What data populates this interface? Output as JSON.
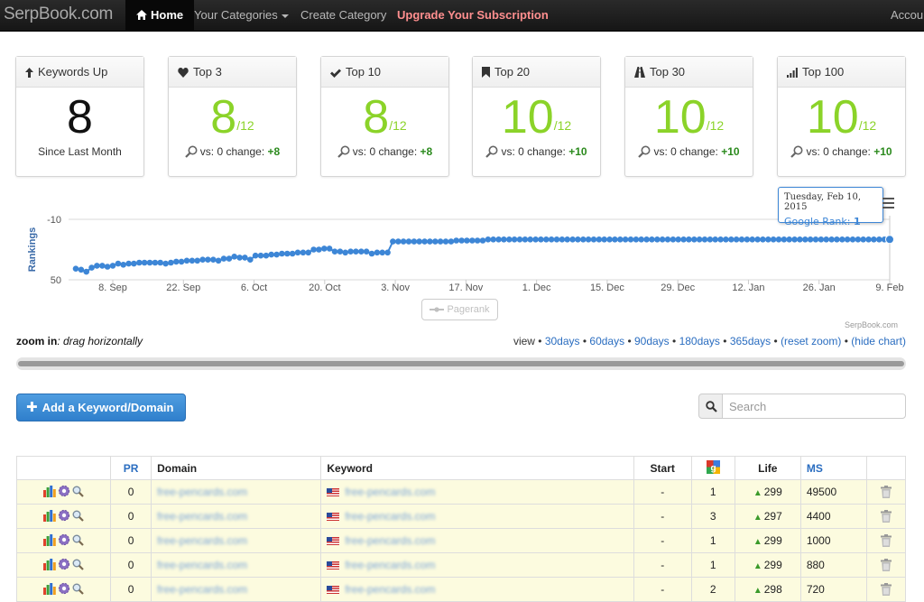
{
  "nav": {
    "brand": "SerpBook.com",
    "home": "Home",
    "categories": "Your Categories",
    "create": "Create Category",
    "upgrade": "Upgrade Your Subscription",
    "account": "Accou"
  },
  "cards": [
    {
      "title": "Keywords Up",
      "icon": "arrow-up-icon",
      "value": "8",
      "suffix": "",
      "foot_text": "Since Last Month",
      "change": ""
    },
    {
      "title": "Top 3",
      "icon": "heart-icon",
      "value": "8",
      "suffix": "/12",
      "foot_text": "vs: 0 change:",
      "change": "+8"
    },
    {
      "title": "Top 10",
      "icon": "check-icon",
      "value": "8",
      "suffix": "/12",
      "foot_text": "vs: 0 change:",
      "change": "+8"
    },
    {
      "title": "Top 20",
      "icon": "bookmark-icon",
      "value": "10",
      "suffix": "/12",
      "foot_text": "vs: 0 change:",
      "change": "+10"
    },
    {
      "title": "Top 30",
      "icon": "road-icon",
      "value": "10",
      "suffix": "/12",
      "foot_text": "vs: 0 change:",
      "change": "+10"
    },
    {
      "title": "Top 100",
      "icon": "signal-icon",
      "value": "10",
      "suffix": "/12",
      "foot_text": "vs: 0 change:",
      "change": "+10"
    }
  ],
  "chart_data": {
    "type": "line",
    "ylabel": "Rankings",
    "y_tick_labels": [
      "-10",
      "50"
    ],
    "y_range": [
      -10,
      50
    ],
    "y_inverted": false,
    "x_tick_labels": [
      "8. Sep",
      "22. Sep",
      "6. Oct",
      "20. Oct",
      "3. Nov",
      "17. Nov",
      "1. Dec",
      "15. Dec",
      "29. Dec",
      "12. Jan",
      "26. Jan",
      "9. Feb"
    ],
    "legend": [
      "Pagerank"
    ],
    "credit": "SerpBook.com",
    "series": [
      {
        "name": "Google Rank",
        "color": "#3d86d6",
        "values": [
          39,
          40,
          42,
          38,
          36,
          36,
          37,
          36,
          34,
          35,
          34,
          34,
          33,
          33,
          33,
          33,
          33,
          34,
          33,
          32,
          32,
          31,
          31,
          31,
          30,
          30,
          30,
          31,
          29,
          29,
          27,
          28,
          28,
          30,
          26,
          26,
          26,
          25,
          25,
          24,
          24,
          24,
          23,
          23,
          23,
          20,
          20,
          19,
          19,
          22,
          22,
          23,
          22,
          22,
          22,
          22,
          24,
          23,
          23,
          23,
          12,
          12,
          12,
          12,
          12,
          12,
          12,
          12,
          12,
          12,
          12,
          12,
          11,
          11,
          11,
          11,
          11,
          11,
          10,
          10,
          10,
          10,
          10,
          10,
          10,
          10,
          10,
          10,
          10,
          10,
          10,
          10,
          10,
          10,
          10,
          10,
          10,
          10,
          10,
          10,
          10,
          10,
          10,
          10,
          10,
          10,
          10,
          10,
          10,
          10,
          10,
          10,
          10,
          10,
          10,
          10,
          10,
          10,
          10,
          10,
          10,
          10,
          10,
          10,
          10,
          10,
          10,
          10,
          10,
          10,
          10,
          10,
          10,
          10,
          10,
          10,
          10,
          10,
          10,
          10,
          10,
          10,
          10,
          10,
          10,
          10,
          10,
          10,
          10,
          10,
          10,
          10,
          10,
          10,
          10
        ]
      }
    ],
    "tooltip": {
      "date": "Tuesday, Feb 10, 2015",
      "label": "Google Rank:",
      "value": "1"
    }
  },
  "zoom": {
    "label_bold": "zoom in",
    "label_rest": ": drag horizontally",
    "view_prefix": "view",
    "links": [
      "30days",
      "60days",
      "90days",
      "180days",
      "365days",
      "(reset zoom)",
      "(hide chart)"
    ]
  },
  "add_button": "Add a Keyword/Domain",
  "search": {
    "placeholder": "Search",
    "value": ""
  },
  "table": {
    "headers": [
      "",
      "PR",
      "Domain",
      "Keyword",
      "Start",
      "",
      "Life",
      "MS",
      ""
    ],
    "rows": [
      {
        "pr": "0",
        "domain": "free-pencards.com",
        "keyword": "free-pencards.com",
        "start": "-",
        "rank": "1",
        "life": "299",
        "ms": "49500"
      },
      {
        "pr": "0",
        "domain": "free-pencards.com",
        "keyword": "free-pencards.com",
        "start": "-",
        "rank": "3",
        "life": "297",
        "ms": "4400"
      },
      {
        "pr": "0",
        "domain": "free-pencards.com",
        "keyword": "free-pencards.com",
        "start": "-",
        "rank": "1",
        "life": "299",
        "ms": "1000"
      },
      {
        "pr": "0",
        "domain": "free-pencards.com",
        "keyword": "free-pencards.com",
        "start": "-",
        "rank": "1",
        "life": "299",
        "ms": "880"
      },
      {
        "pr": "0",
        "domain": "free-pencards.com",
        "keyword": "free-pencards.com",
        "start": "-",
        "rank": "2",
        "life": "298",
        "ms": "720"
      }
    ]
  }
}
